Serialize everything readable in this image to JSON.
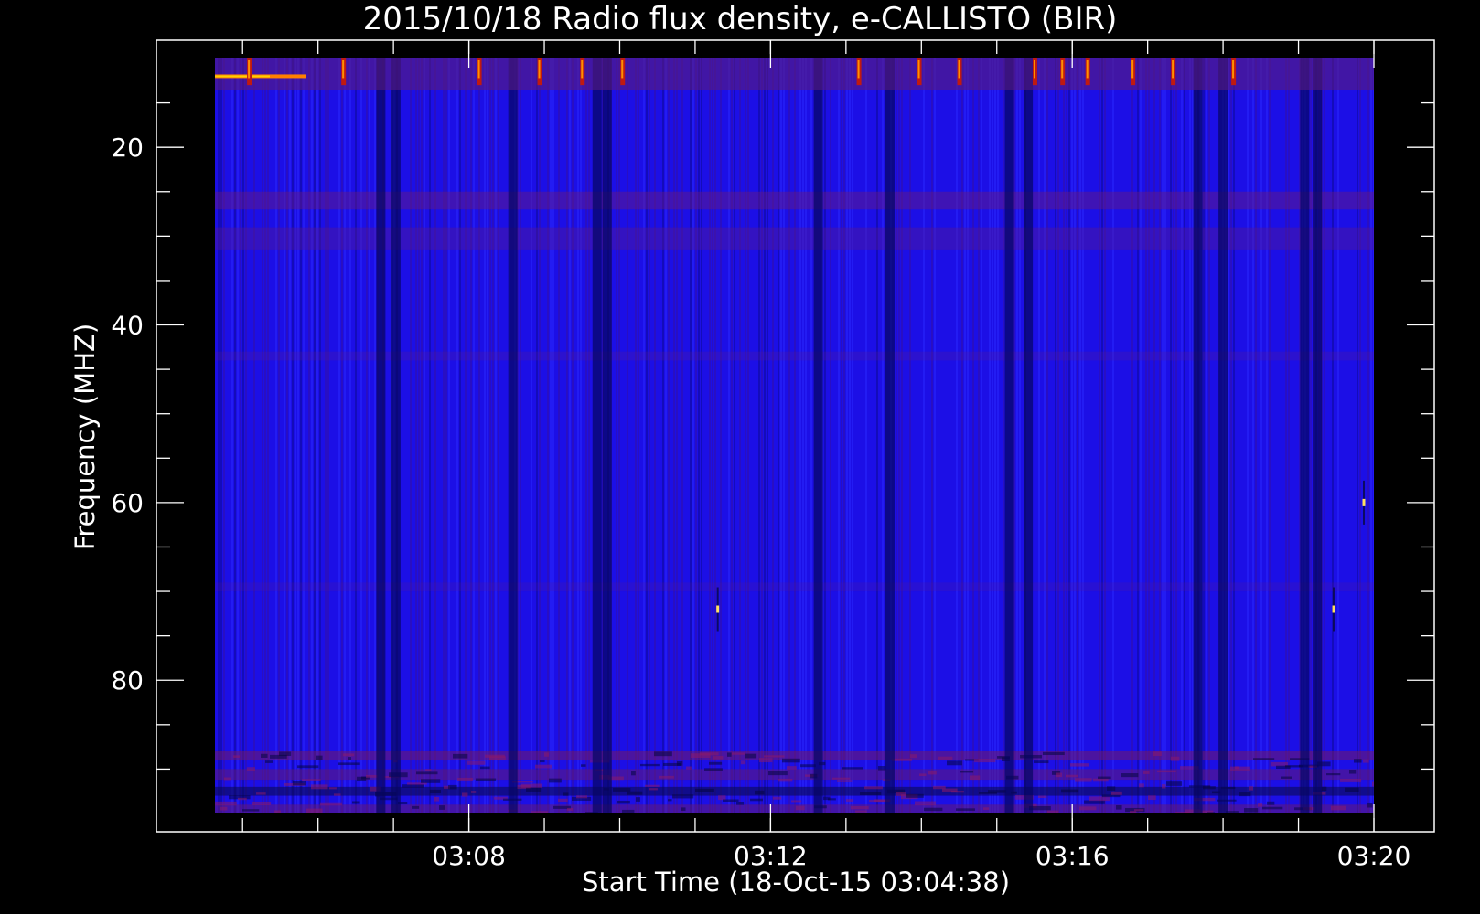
{
  "chart_data": {
    "type": "heatmap",
    "title": "2015/10/18  Radio flux density, e-CALLISTO (BIR)",
    "xlabel": "Start Time (18-Oct-15 03:04:38)",
    "ylabel": "Frequency (MHZ)",
    "x_start": "03:04:38",
    "x_end": "03:20:00",
    "x_tick_labels": [
      "03:08",
      "03:12",
      "03:16",
      "03:20"
    ],
    "x_tick_times": [
      "03:08",
      "03:12",
      "03:16",
      "03:20"
    ],
    "y_tick_labels": [
      "20",
      "40",
      "60",
      "80"
    ],
    "y_tick_values": [
      20,
      40,
      60,
      80
    ],
    "ylim": [
      10,
      95
    ],
    "y_inverted": true,
    "grid": false,
    "colormap": [
      "#000000",
      "#0a0a8a",
      "#1a1aff",
      "#6a1a8a",
      "#b01a1a",
      "#ff4000",
      "#ffd000",
      "#ffffff"
    ],
    "features": {
      "dark_vertical_lanes_time": [
        "03:06:50",
        "03:07:02",
        "03:08:35",
        "03:09:42",
        "03:09:50",
        "03:12:38",
        "03:13:35",
        "03:15:10",
        "03:15:25",
        "03:17:40",
        "03:18:00",
        "03:19:05",
        "03:19:15"
      ],
      "bright_bursts_time": [
        "03:05:05",
        "03:06:20",
        "03:08:08",
        "03:08:56",
        "03:09:30",
        "03:10:02",
        "03:13:10",
        "03:13:58",
        "03:14:30",
        "03:15:30",
        "03:15:52",
        "03:16:12",
        "03:16:48",
        "03:17:20",
        "03:18:08"
      ],
      "bright_band_frequency_mhz": 12,
      "low_frequency_noise_band_mhz": [
        88,
        95
      ],
      "spike_points": [
        {
          "time": "03:11:18",
          "freq": 72
        },
        {
          "time": "03:19:28",
          "freq": 72
        },
        {
          "time": "03:19:52",
          "freq": 60
        }
      ]
    }
  }
}
